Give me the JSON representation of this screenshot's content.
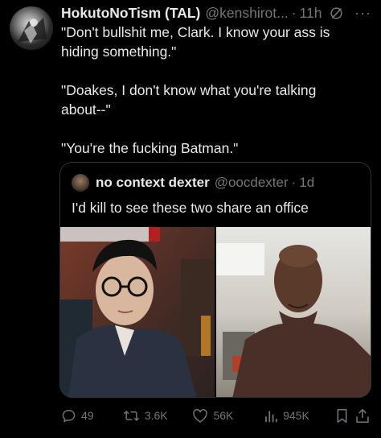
{
  "tweet": {
    "display_name": "HokutoNoTism (TAL)",
    "handle": "@kenshirot...",
    "separator": "·",
    "time": "11h",
    "paragraphs": [
      "\"Don't bullshit me, Clark. I know your ass is hiding something.\"",
      "\"Doakes, I don't know what you're talking about--\"",
      "\"You're the fucking Batman.\""
    ],
    "icons": {
      "avatar": "avatar",
      "grok": "grok-icon",
      "more": "more-icon"
    }
  },
  "quote": {
    "display_name": "no context dexter",
    "handle": "@oocdexter",
    "separator": "·",
    "time": "1d",
    "text": "I'd kill to see these two share an office",
    "media": [
      "left-photo",
      "right-photo"
    ]
  },
  "actions": {
    "replies": "49",
    "reposts": "3.6K",
    "likes": "56K",
    "views": "945K",
    "icons": [
      "reply-icon",
      "repost-icon",
      "like-icon",
      "views-icon",
      "bookmark-icon",
      "share-icon"
    ]
  },
  "colors": {
    "background": "#000000",
    "text": "#e7e9ea",
    "muted": "#71767b",
    "border": "#2f3336"
  }
}
